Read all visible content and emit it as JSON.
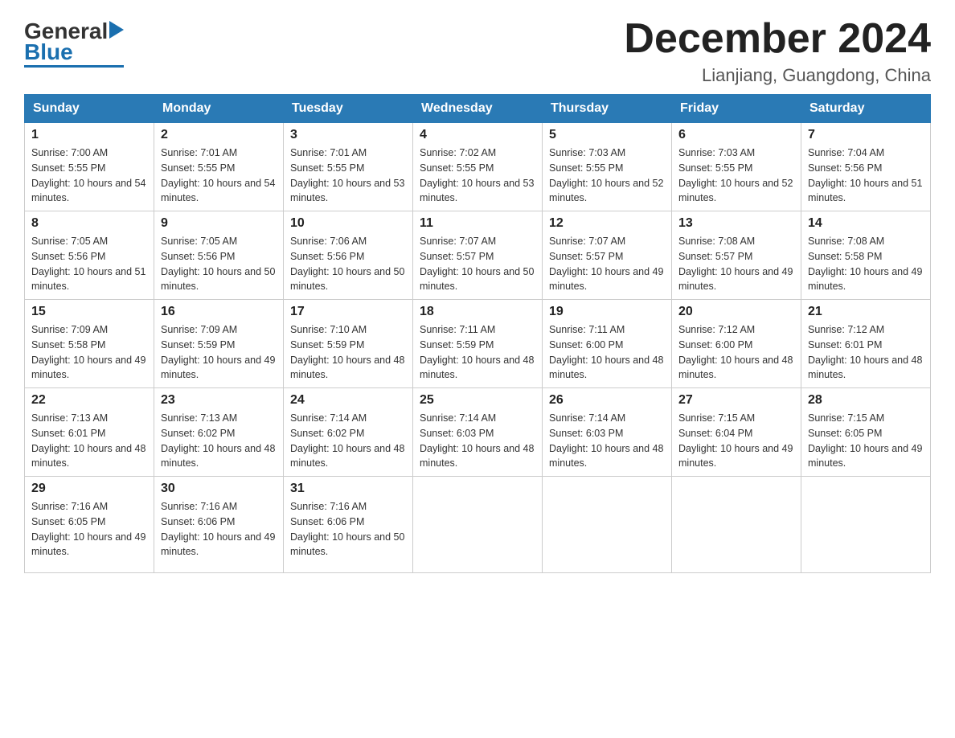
{
  "header": {
    "logo": {
      "general": "General",
      "blue": "Blue",
      "triangle": "▶"
    },
    "title": "December 2024",
    "location": "Lianjiang, Guangdong, China"
  },
  "days_of_week": [
    "Sunday",
    "Monday",
    "Tuesday",
    "Wednesday",
    "Thursday",
    "Friday",
    "Saturday"
  ],
  "weeks": [
    [
      {
        "day": "1",
        "sunrise": "7:00 AM",
        "sunset": "5:55 PM",
        "daylight": "10 hours and 54 minutes."
      },
      {
        "day": "2",
        "sunrise": "7:01 AM",
        "sunset": "5:55 PM",
        "daylight": "10 hours and 54 minutes."
      },
      {
        "day": "3",
        "sunrise": "7:01 AM",
        "sunset": "5:55 PM",
        "daylight": "10 hours and 53 minutes."
      },
      {
        "day": "4",
        "sunrise": "7:02 AM",
        "sunset": "5:55 PM",
        "daylight": "10 hours and 53 minutes."
      },
      {
        "day": "5",
        "sunrise": "7:03 AM",
        "sunset": "5:55 PM",
        "daylight": "10 hours and 52 minutes."
      },
      {
        "day": "6",
        "sunrise": "7:03 AM",
        "sunset": "5:55 PM",
        "daylight": "10 hours and 52 minutes."
      },
      {
        "day": "7",
        "sunrise": "7:04 AM",
        "sunset": "5:56 PM",
        "daylight": "10 hours and 51 minutes."
      }
    ],
    [
      {
        "day": "8",
        "sunrise": "7:05 AM",
        "sunset": "5:56 PM",
        "daylight": "10 hours and 51 minutes."
      },
      {
        "day": "9",
        "sunrise": "7:05 AM",
        "sunset": "5:56 PM",
        "daylight": "10 hours and 50 minutes."
      },
      {
        "day": "10",
        "sunrise": "7:06 AM",
        "sunset": "5:56 PM",
        "daylight": "10 hours and 50 minutes."
      },
      {
        "day": "11",
        "sunrise": "7:07 AM",
        "sunset": "5:57 PM",
        "daylight": "10 hours and 50 minutes."
      },
      {
        "day": "12",
        "sunrise": "7:07 AM",
        "sunset": "5:57 PM",
        "daylight": "10 hours and 49 minutes."
      },
      {
        "day": "13",
        "sunrise": "7:08 AM",
        "sunset": "5:57 PM",
        "daylight": "10 hours and 49 minutes."
      },
      {
        "day": "14",
        "sunrise": "7:08 AM",
        "sunset": "5:58 PM",
        "daylight": "10 hours and 49 minutes."
      }
    ],
    [
      {
        "day": "15",
        "sunrise": "7:09 AM",
        "sunset": "5:58 PM",
        "daylight": "10 hours and 49 minutes."
      },
      {
        "day": "16",
        "sunrise": "7:09 AM",
        "sunset": "5:59 PM",
        "daylight": "10 hours and 49 minutes."
      },
      {
        "day": "17",
        "sunrise": "7:10 AM",
        "sunset": "5:59 PM",
        "daylight": "10 hours and 48 minutes."
      },
      {
        "day": "18",
        "sunrise": "7:11 AM",
        "sunset": "5:59 PM",
        "daylight": "10 hours and 48 minutes."
      },
      {
        "day": "19",
        "sunrise": "7:11 AM",
        "sunset": "6:00 PM",
        "daylight": "10 hours and 48 minutes."
      },
      {
        "day": "20",
        "sunrise": "7:12 AM",
        "sunset": "6:00 PM",
        "daylight": "10 hours and 48 minutes."
      },
      {
        "day": "21",
        "sunrise": "7:12 AM",
        "sunset": "6:01 PM",
        "daylight": "10 hours and 48 minutes."
      }
    ],
    [
      {
        "day": "22",
        "sunrise": "7:13 AM",
        "sunset": "6:01 PM",
        "daylight": "10 hours and 48 minutes."
      },
      {
        "day": "23",
        "sunrise": "7:13 AM",
        "sunset": "6:02 PM",
        "daylight": "10 hours and 48 minutes."
      },
      {
        "day": "24",
        "sunrise": "7:14 AM",
        "sunset": "6:02 PM",
        "daylight": "10 hours and 48 minutes."
      },
      {
        "day": "25",
        "sunrise": "7:14 AM",
        "sunset": "6:03 PM",
        "daylight": "10 hours and 48 minutes."
      },
      {
        "day": "26",
        "sunrise": "7:14 AM",
        "sunset": "6:03 PM",
        "daylight": "10 hours and 48 minutes."
      },
      {
        "day": "27",
        "sunrise": "7:15 AM",
        "sunset": "6:04 PM",
        "daylight": "10 hours and 49 minutes."
      },
      {
        "day": "28",
        "sunrise": "7:15 AM",
        "sunset": "6:05 PM",
        "daylight": "10 hours and 49 minutes."
      }
    ],
    [
      {
        "day": "29",
        "sunrise": "7:16 AM",
        "sunset": "6:05 PM",
        "daylight": "10 hours and 49 minutes."
      },
      {
        "day": "30",
        "sunrise": "7:16 AM",
        "sunset": "6:06 PM",
        "daylight": "10 hours and 49 minutes."
      },
      {
        "day": "31",
        "sunrise": "7:16 AM",
        "sunset": "6:06 PM",
        "daylight": "10 hours and 50 minutes."
      },
      null,
      null,
      null,
      null
    ]
  ],
  "labels": {
    "sunrise": "Sunrise:",
    "sunset": "Sunset:",
    "daylight": "Daylight:"
  },
  "colors": {
    "header_bg": "#2a7ab5",
    "header_text": "#ffffff",
    "border": "#cccccc",
    "day_number": "#222222",
    "day_info": "#333333"
  }
}
